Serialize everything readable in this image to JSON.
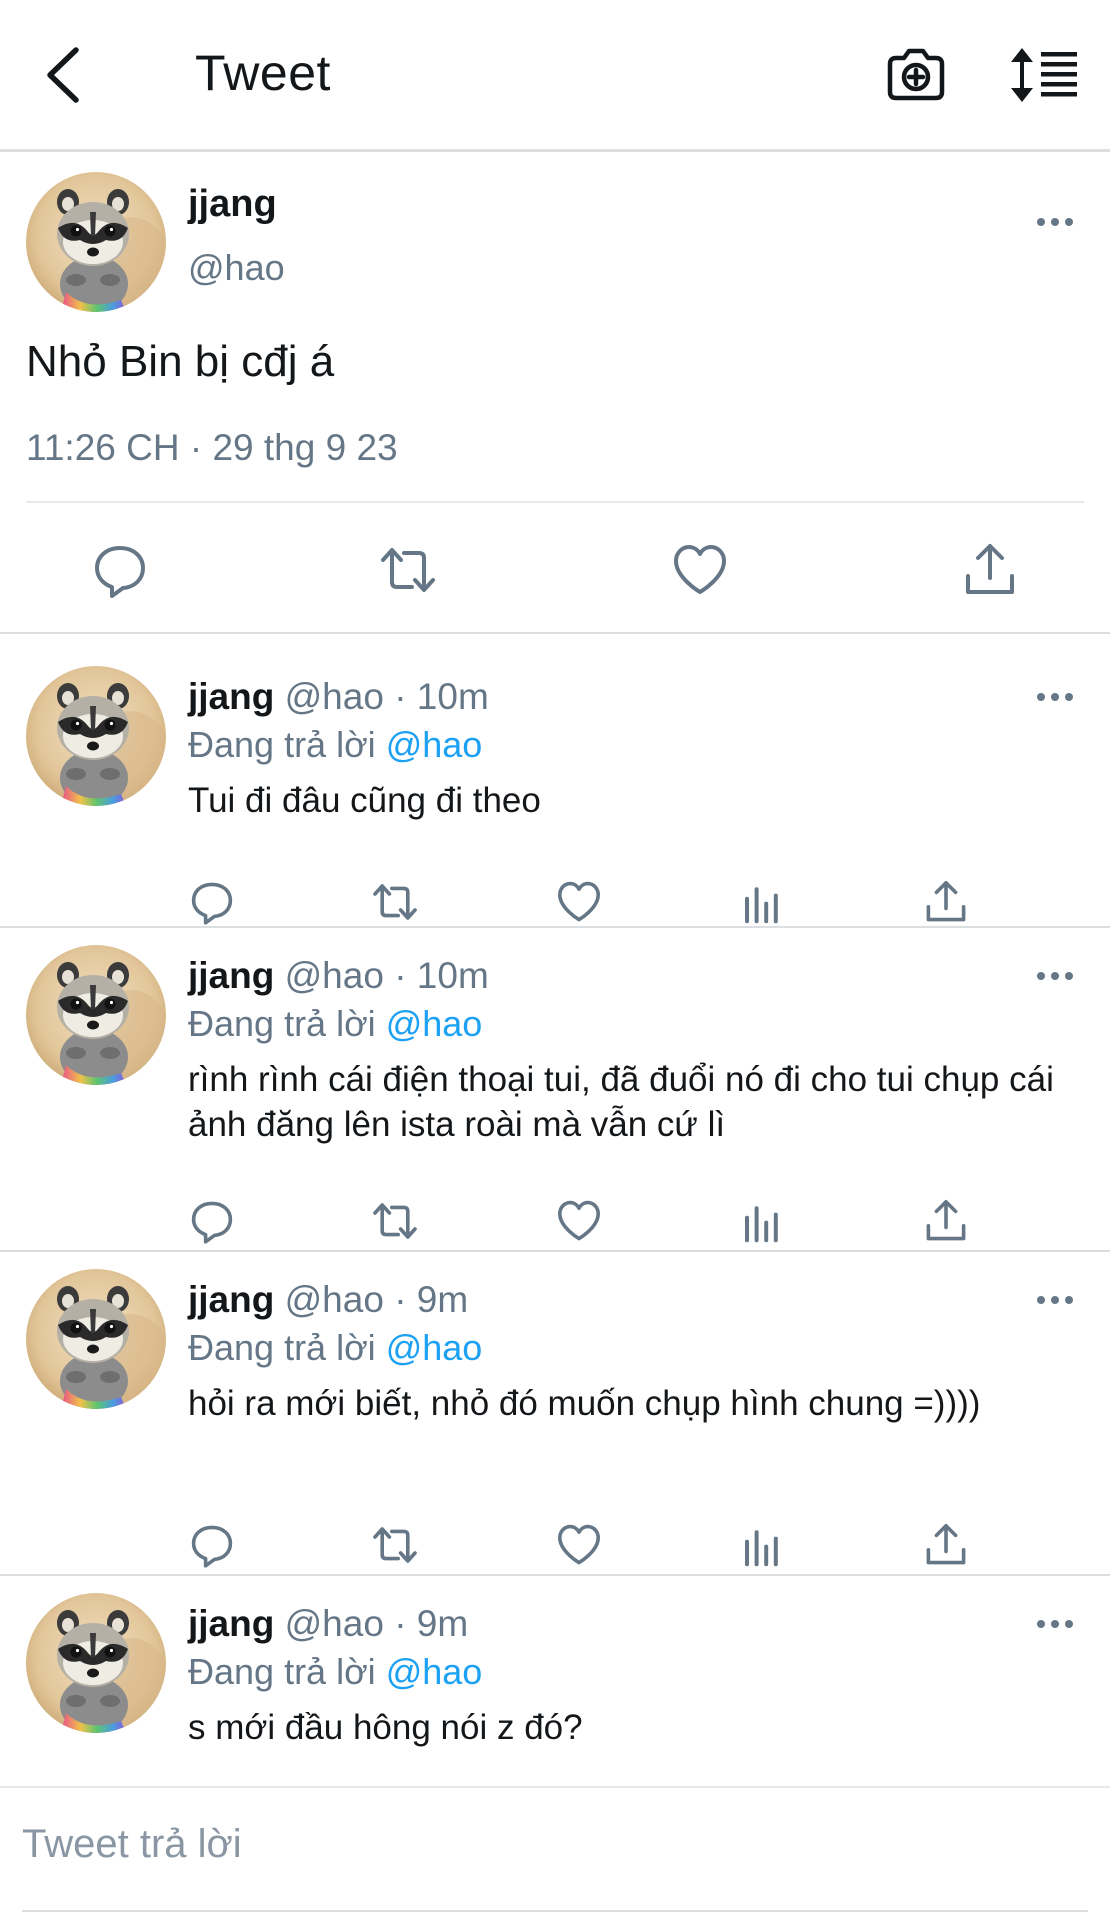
{
  "header": {
    "title": "Tweet",
    "back_icon": "chevron-left-icon",
    "camera_icon": "camera-plus-icon",
    "sort_icon": "sort-list-icon"
  },
  "main_tweet": {
    "author_name": "jjang",
    "author_handle": "@hao",
    "text": "Nhỏ Bin bị cđj á",
    "timestamp": "11:26 CH · 29 thg 9 23",
    "actions": [
      "reply-icon",
      "retweet-icon",
      "like-icon",
      "share-icon"
    ]
  },
  "replies": [
    {
      "author_name": "jjang",
      "meta": "@hao · 10m",
      "replying_prefix": "Đang trả lời",
      "replying_to": "@hao",
      "text": "Tui đi đâu cũng đi theo"
    },
    {
      "author_name": "jjang",
      "meta": "@hao · 10m",
      "replying_prefix": "Đang trả lời",
      "replying_to": "@hao",
      "text": "rình rình cái điện thoại tui, đã đuổi nó đi cho tui chụp cái ảnh đăng lên ista roài mà vẫn cứ lì"
    },
    {
      "author_name": "jjang",
      "meta": "@hao · 9m",
      "replying_prefix": "Đang trả lời",
      "replying_to": "@hao",
      "text": "hỏi ra mới biết, nhỏ đó muốn chụp hình chung =))))"
    },
    {
      "author_name": "jjang",
      "meta": "@hao · 9m",
      "replying_prefix": "Đang trả lời",
      "replying_to": "@hao",
      "text": "s mới đầu hông nói z đó?"
    }
  ],
  "composer": {
    "placeholder": "Tweet trả lời"
  },
  "colors": {
    "accent": "#1da1f2",
    "text_primary": "#14171a",
    "text_secondary": "#657786",
    "divider": "#dcdfe2"
  }
}
